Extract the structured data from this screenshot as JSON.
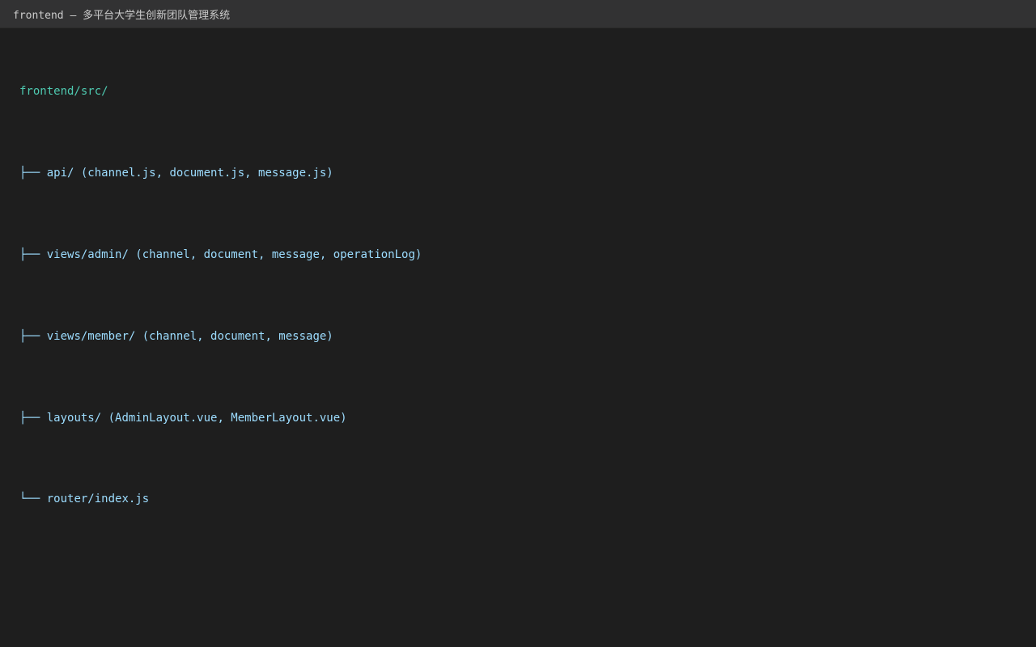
{
  "window": {
    "title": "frontend — 多平台大学生创新团队管理系统"
  },
  "tree": {
    "root": "frontend/src/",
    "branch_mid": "├──",
    "branch_last": "└──",
    "items": [
      "api/ (channel.js, document.js, message.js)",
      "views/admin/ (channel, document, message, operationLog)",
      "views/member/ (channel, document, message)",
      "layouts/ (AdminLayout.vue, MemberLayout.vue)",
      "router/index.js"
    ]
  },
  "colors": {
    "background": "#1e1e1e",
    "titlebar": "#323233",
    "root_text": "#4ec9b0",
    "entry_text": "#9cdcfe"
  }
}
